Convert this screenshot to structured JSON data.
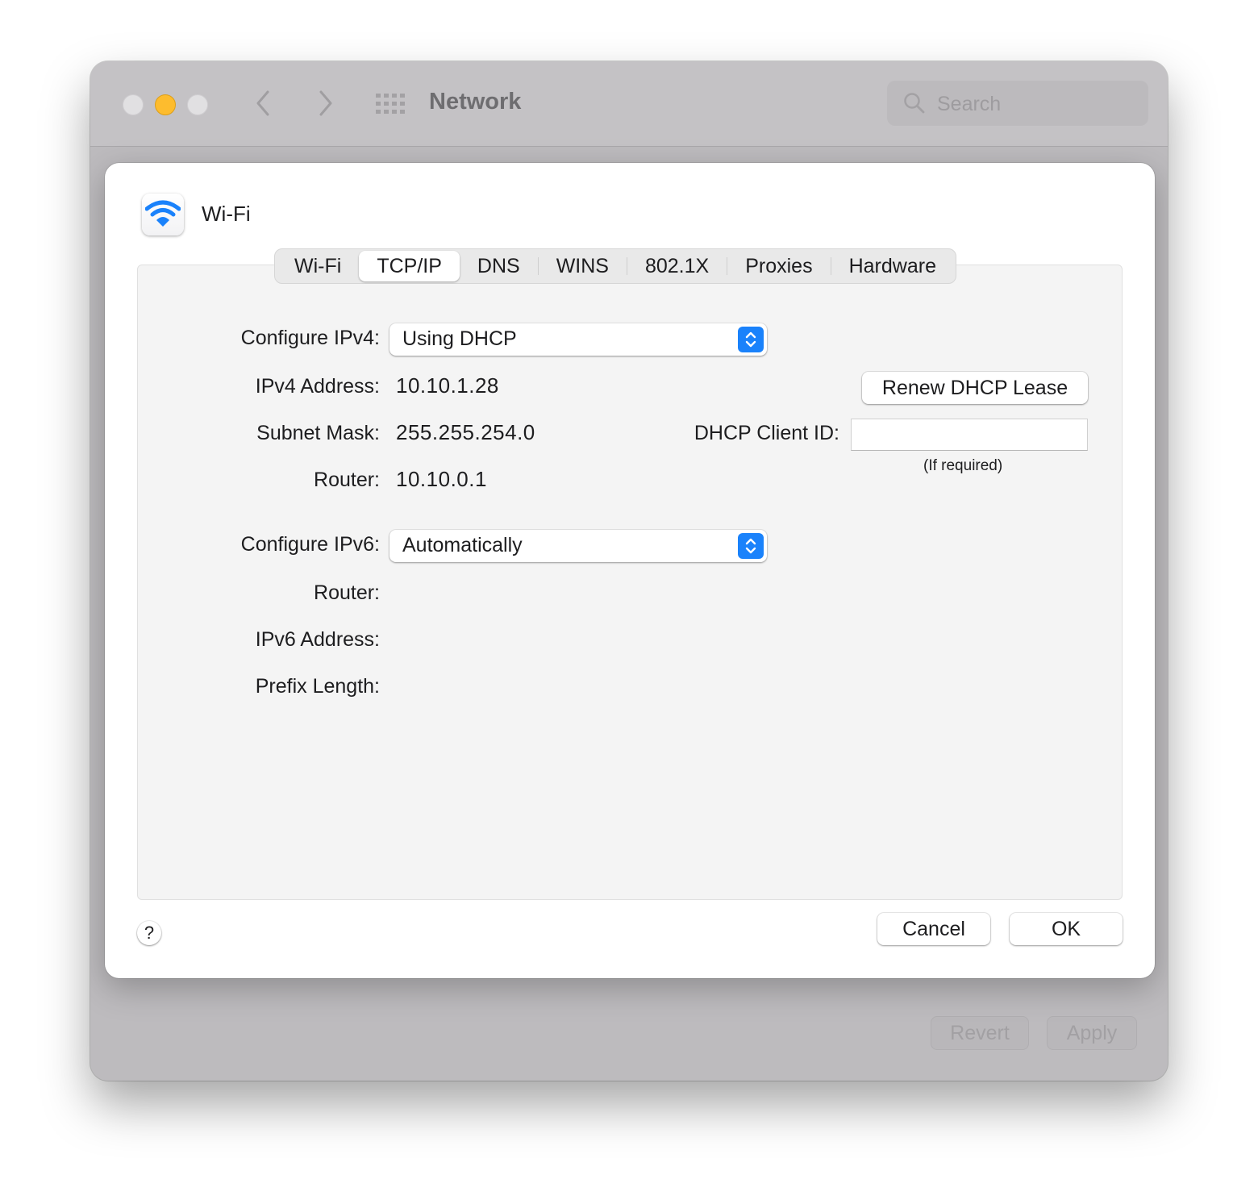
{
  "window": {
    "title": "Network",
    "search": {
      "placeholder": "Search",
      "value": ""
    },
    "icons": {
      "close": "traffic-light-close",
      "minimize": "traffic-light-minimize",
      "zoom": "traffic-light-zoom",
      "back": "chevron-left-icon",
      "forward": "chevron-right-icon",
      "show_all": "grid-icon",
      "search": "magnifying-glass-icon"
    },
    "bottom_buttons": {
      "revert": "Revert",
      "apply": "Apply"
    }
  },
  "sheet": {
    "service": {
      "name": "Wi-Fi",
      "icon": "wifi-icon",
      "accent": "#1a82fb"
    },
    "tabs": [
      {
        "label": "Wi-Fi",
        "active": false
      },
      {
        "label": "TCP/IP",
        "active": true
      },
      {
        "label": "DNS",
        "active": false
      },
      {
        "label": "WINS",
        "active": false
      },
      {
        "label": "802.1X",
        "active": false
      },
      {
        "label": "Proxies",
        "active": false
      },
      {
        "label": "Hardware",
        "active": false
      }
    ],
    "ipv4": {
      "configure_label": "Configure IPv4:",
      "configure_value": "Using DHCP",
      "address_label": "IPv4 Address:",
      "address_value": "10.10.1.28",
      "subnet_label": "Subnet Mask:",
      "subnet_value": "255.255.254.0",
      "router_label": "Router:",
      "router_value": "10.10.0.1",
      "renew_button": "Renew DHCP Lease",
      "client_id_label": "DHCP Client ID:",
      "client_id_value": "",
      "client_id_hint": "(If required)"
    },
    "ipv6": {
      "configure_label": "Configure IPv6:",
      "configure_value": "Automatically",
      "router_label": "Router:",
      "router_value": "",
      "address_label": "IPv6 Address:",
      "address_value": "",
      "prefix_label": "Prefix Length:",
      "prefix_value": ""
    },
    "help_label": "?",
    "cancel_button": "Cancel",
    "ok_button": "OK"
  }
}
